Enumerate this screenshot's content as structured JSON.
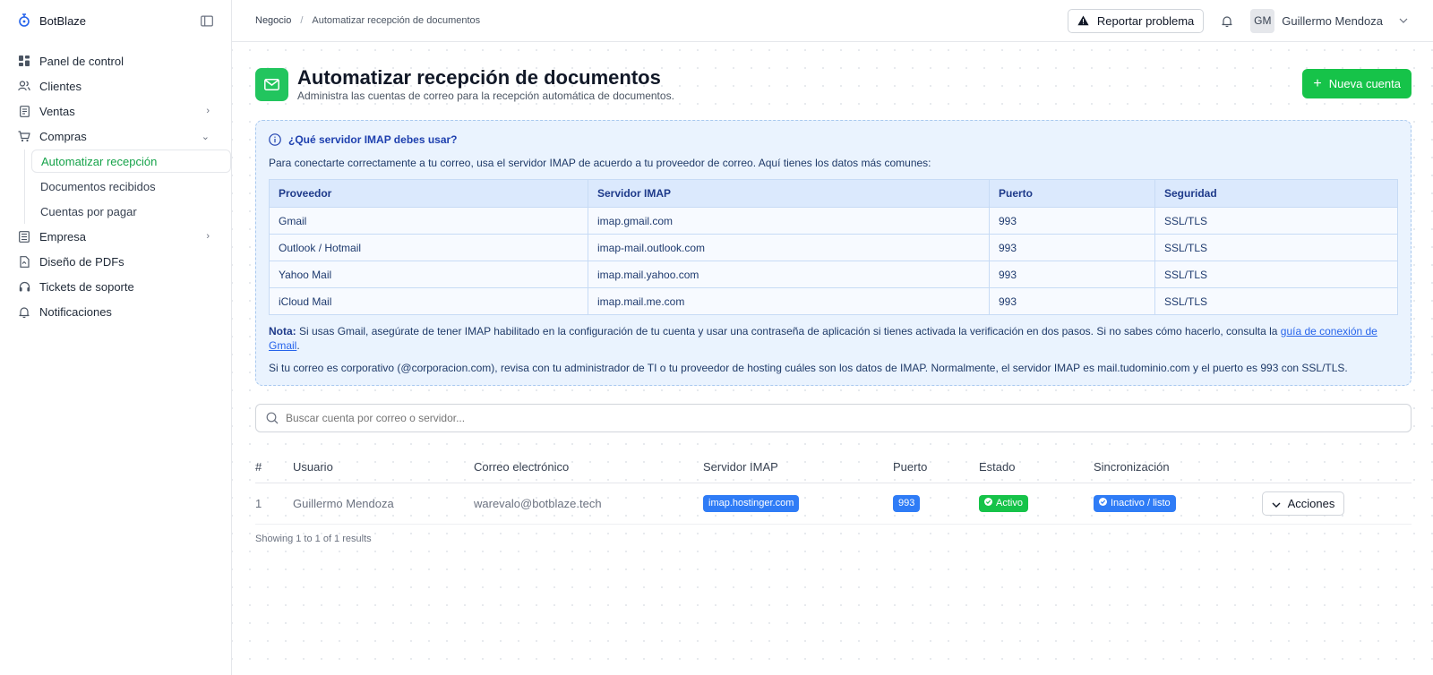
{
  "brand": {
    "name": "BotBlaze"
  },
  "sidebar": {
    "items": [
      {
        "label": "Panel de control",
        "icon": "dashboard-icon"
      },
      {
        "label": "Clientes",
        "icon": "users-icon"
      },
      {
        "label": "Ventas",
        "icon": "receipt-icon"
      },
      {
        "label": "Compras",
        "icon": "cart-icon"
      },
      {
        "label": "Empresa",
        "icon": "building-icon"
      },
      {
        "label": "Diseño de PDFs",
        "icon": "pdf-icon"
      },
      {
        "label": "Tickets de soporte",
        "icon": "headset-icon"
      },
      {
        "label": "Notificaciones",
        "icon": "bell-icon"
      }
    ],
    "compras_sub": [
      {
        "label": "Automatizar recepción"
      },
      {
        "label": "Documentos recibidos"
      },
      {
        "label": "Cuentas por pagar"
      }
    ]
  },
  "topbar": {
    "breadcrumb_root": "Negocio",
    "breadcrumb_sep": "/",
    "breadcrumb_current": "Automatizar recepción de documentos",
    "report_label": "Reportar problema",
    "avatar_initials": "GM",
    "user_name": "Guillermo Mendoza"
  },
  "page": {
    "title": "Automatizar recepción de documentos",
    "subtitle": "Administra las cuentas de correo para la recepción automática de documentos.",
    "new_button": "Nueva cuenta"
  },
  "info": {
    "heading": "¿Qué servidor IMAP debes usar?",
    "intro": "Para conectarte correctamente a tu correo, usa el servidor IMAP de acuerdo a tu proveedor de correo. Aquí tienes los datos más comunes:",
    "columns": [
      "Proveedor",
      "Servidor IMAP",
      "Puerto",
      "Seguridad"
    ],
    "rows": [
      [
        "Gmail",
        "imap.gmail.com",
        "993",
        "SSL/TLS"
      ],
      [
        "Outlook / Hotmail",
        "imap-mail.outlook.com",
        "993",
        "SSL/TLS"
      ],
      [
        "Yahoo Mail",
        "imap.mail.yahoo.com",
        "993",
        "SSL/TLS"
      ],
      [
        "iCloud Mail",
        "imap.mail.me.com",
        "993",
        "SSL/TLS"
      ]
    ],
    "note_label": "Nota:",
    "note_text": " Si usas Gmail, asegúrate de tener IMAP habilitado en la configuración de tu cuenta y usar una contraseña de aplicación si tienes activada la verificación en dos pasos. Si no sabes cómo hacerlo, consulta la ",
    "note_link": "guía de conexión de Gmail",
    "note_end": ".",
    "note2": "Si tu correo es corporativo (@corporacion.com), revisa con tu administrador de TI o tu proveedor de hosting cuáles son los datos de IMAP. Normalmente, el servidor IMAP es mail.tudominio.com y el puerto es 993 con SSL/TLS."
  },
  "search": {
    "placeholder": "Buscar cuenta por correo o servidor..."
  },
  "accounts": {
    "columns": [
      "#",
      "Usuario",
      "Correo electrónico",
      "Servidor IMAP",
      "Puerto",
      "Estado",
      "Sincronización",
      ""
    ],
    "rows": [
      {
        "num": "1",
        "user": "Guillermo Mendoza",
        "email": "warevalo@botblaze.tech",
        "server": "imap.hostinger.com",
        "port": "993",
        "status": "Activo",
        "sync": "Inactivo / listo",
        "actions": "Acciones"
      }
    ],
    "results": "Showing 1 to 1 of 1 results"
  },
  "colors": {
    "accent_green": "#16c349",
    "info_blue": "#eaf3fe",
    "pill_blue": "#2f7cf6"
  }
}
